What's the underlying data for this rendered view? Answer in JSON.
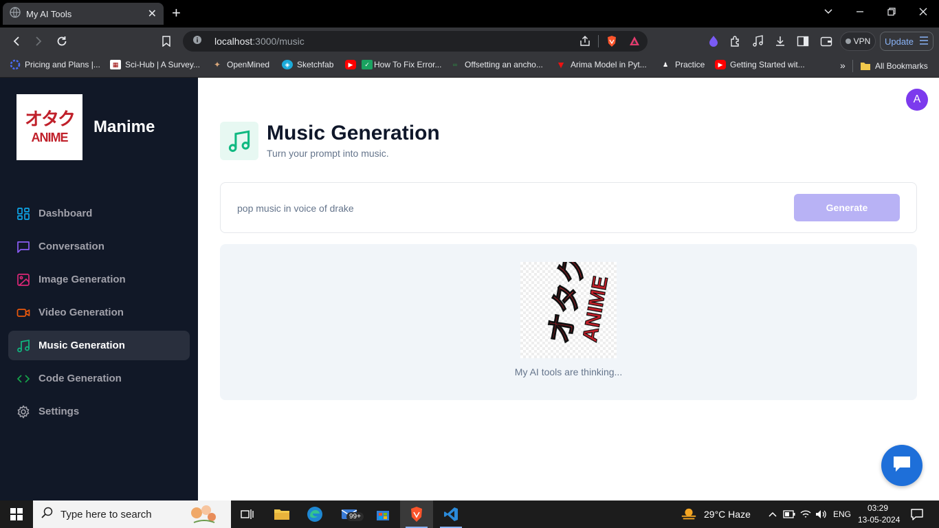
{
  "browser": {
    "tab_title": "My AI Tools",
    "url_host": "localhost",
    "url_path": ":3000/music",
    "vpn_label": "VPN",
    "update_label": "Update",
    "bookmarks": [
      "Pricing and Plans |...",
      "Sci-Hub | A Survey...",
      "OpenMined",
      "Sketchfab",
      "How To Fix Error...",
      "Offsetting an ancho...",
      "Arima Model in Pyt...",
      "Practice",
      "Getting Started wit..."
    ],
    "all_bookmarks": "All Bookmarks",
    "bookmarks_overflow": "»"
  },
  "sidebar": {
    "brand": "Manime",
    "logo_text_top": "オタク",
    "logo_text_bottom": "ANIME",
    "items": [
      {
        "label": "Dashboard",
        "icon": "layout-dashboard-icon",
        "color": "#0ea5e9"
      },
      {
        "label": "Conversation",
        "icon": "message-square-icon",
        "color": "#8b5cf6"
      },
      {
        "label": "Image Generation",
        "icon": "image-icon",
        "color": "#db2777"
      },
      {
        "label": "Video Generation",
        "icon": "video-icon",
        "color": "#ea580c"
      },
      {
        "label": "Music Generation",
        "icon": "music-icon",
        "color": "#10b981"
      },
      {
        "label": "Code Generation",
        "icon": "code-icon",
        "color": "#16a34a"
      },
      {
        "label": "Settings",
        "icon": "settings-icon",
        "color": "#a1a1aa"
      }
    ],
    "active_index": 4
  },
  "main": {
    "avatar_letter": "A",
    "title": "Music Generation",
    "subtitle": "Turn your prompt into music.",
    "prompt_value": "pop music in voice of drake",
    "generate_label": "Generate",
    "loading_text": "My AI tools are thinking..."
  },
  "taskbar": {
    "search_placeholder": "Type here to search",
    "badge": "99+",
    "weather": "29°C  Haze",
    "lang": "ENG",
    "time": "03:29",
    "date": "13-05-2024"
  },
  "colors": {
    "sidebar_bg": "#111827",
    "accent_music": "#10b981",
    "generate_bg": "#b8b2f5",
    "avatar_bg": "#7c3aed",
    "chat_fab": "#1e6fd9"
  }
}
